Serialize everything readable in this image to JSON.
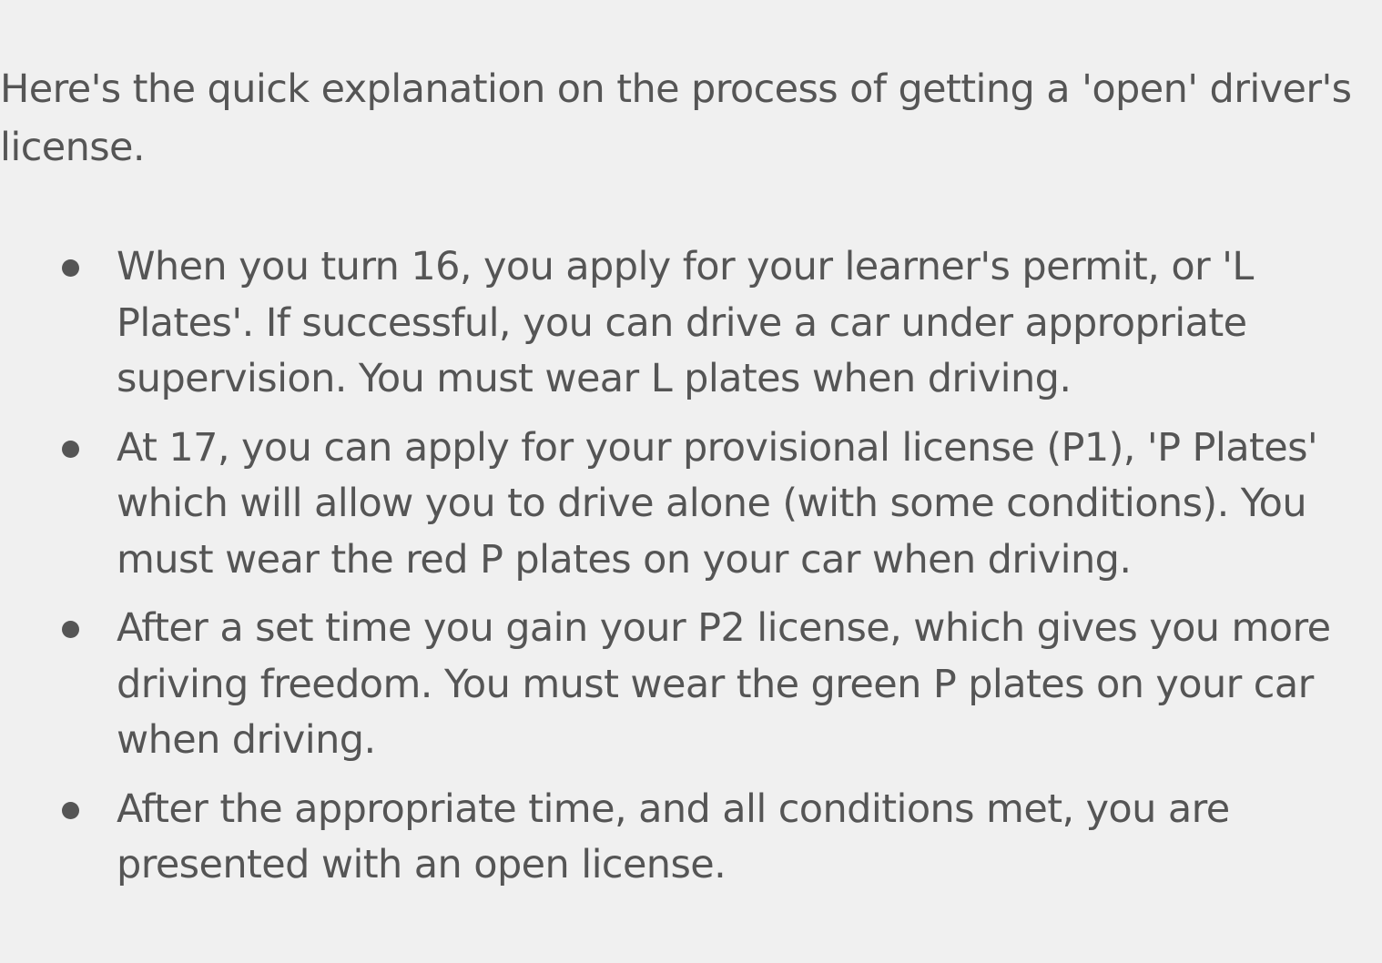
{
  "intro": "Here's the quick explanation on the process of getting a 'open' driver's license.",
  "steps": [
    "When you turn 16, you apply for your learner's permit, or 'L Plates'. If successful, you can drive a car under appropriate supervision. You must wear L plates when driving.",
    "At 17, you can apply for your provisional license (P1), 'P Plates' which will allow you to drive alone (with some conditions). You must wear the red P plates on your car when driving.",
    "After a set time you gain your P2 license, which gives you more driving freedom. You must wear the green P plates on your car when driving.",
    "After the appropriate time, and all conditions met, you are presented with an open license."
  ],
  "colors": {
    "background": "#f0f0f0",
    "text": "#555555"
  }
}
